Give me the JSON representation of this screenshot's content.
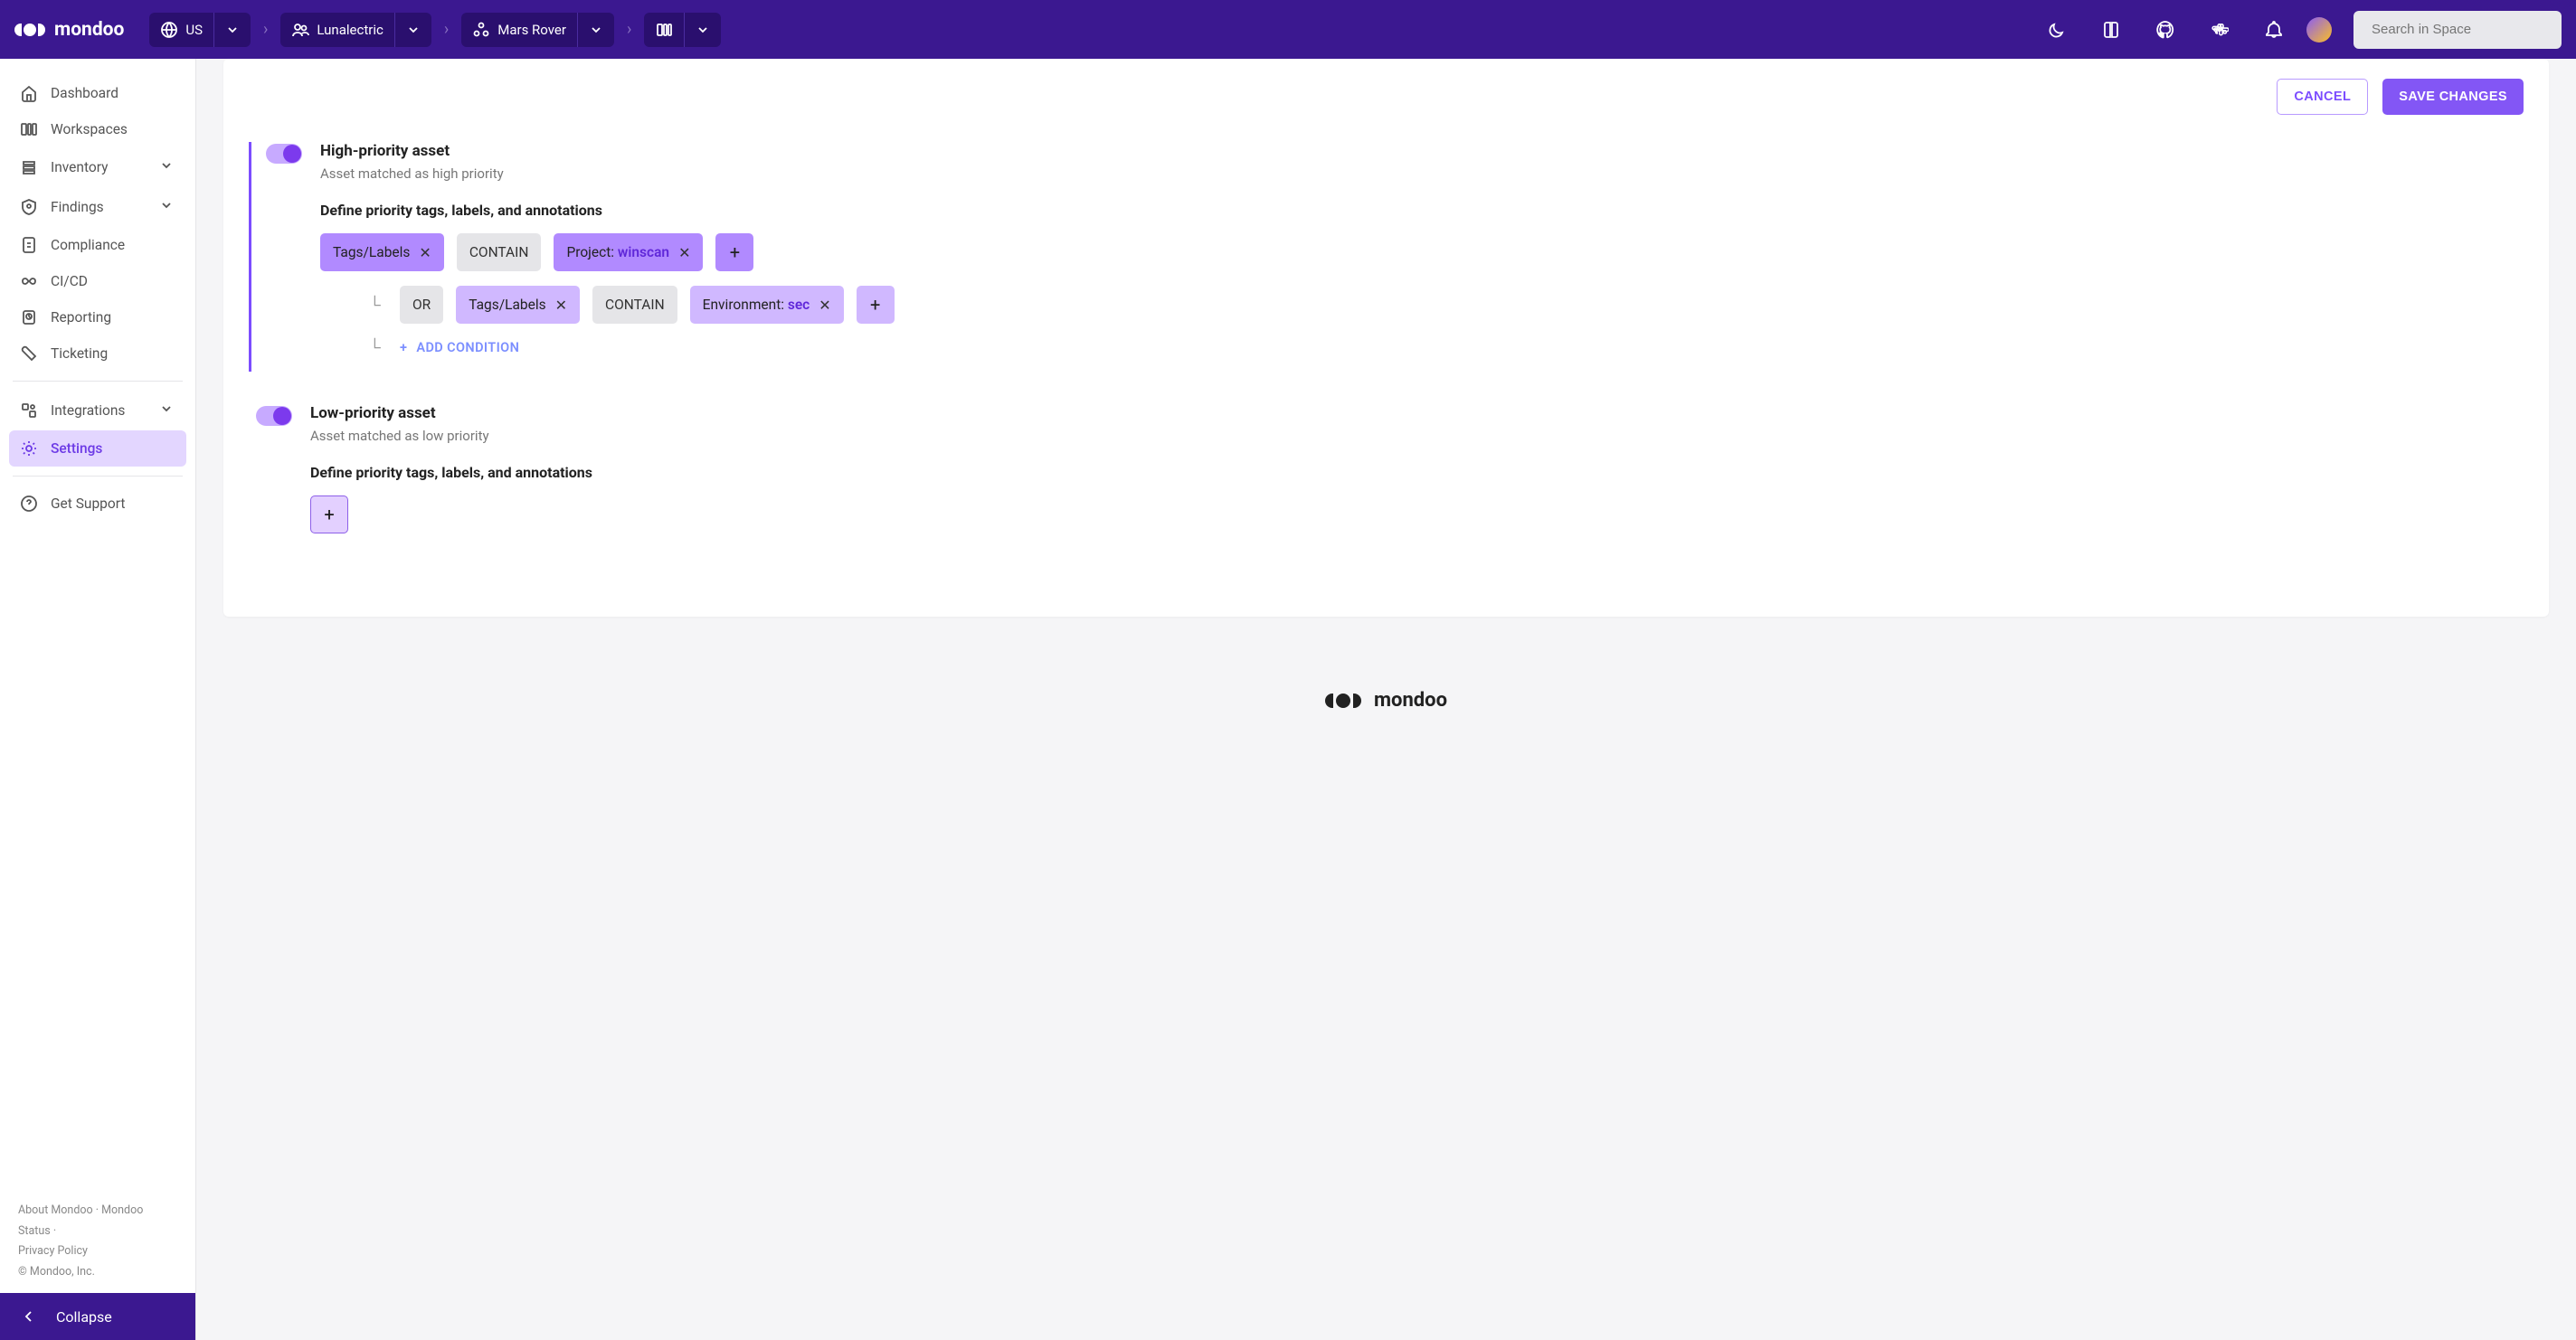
{
  "brand": "mondoo",
  "breadcrumbs": {
    "region": "US",
    "org": "Lunalectric",
    "space": "Mars Rover"
  },
  "search": {
    "placeholder": "Search in Space"
  },
  "sidebar": {
    "items": [
      {
        "label": "Dashboard"
      },
      {
        "label": "Workspaces"
      },
      {
        "label": "Inventory",
        "expandable": true
      },
      {
        "label": "Findings",
        "expandable": true
      },
      {
        "label": "Compliance"
      },
      {
        "label": "CI/CD"
      },
      {
        "label": "Reporting"
      },
      {
        "label": "Ticketing"
      }
    ],
    "secondary": [
      {
        "label": "Integrations",
        "expandable": true
      },
      {
        "label": "Settings",
        "active": true
      }
    ],
    "support": "Get Support",
    "footer": {
      "about": "About Mondoo",
      "status": "Mondoo Status",
      "privacy": "Privacy Policy",
      "copyright": "© Mondoo, Inc."
    },
    "collapse": "Collapse"
  },
  "actions": {
    "cancel": "CANCEL",
    "save": "SAVE CHANGES"
  },
  "sections": {
    "high": {
      "title": "High-priority asset",
      "subtitle": "Asset matched as high priority",
      "heading": "Define priority tags, labels, and annotations",
      "row1": {
        "field": "Tags/Labels",
        "op": "CONTAIN",
        "key": "Project:",
        "val": "winscan"
      },
      "row2": {
        "join": "OR",
        "field": "Tags/Labels",
        "op": "CONTAIN",
        "key": "Environment:",
        "val": "sec"
      },
      "add": "ADD CONDITION"
    },
    "low": {
      "title": "Low-priority asset",
      "subtitle": "Asset matched as low priority",
      "heading": "Define priority tags, labels, and annotations"
    }
  },
  "plus": "+"
}
